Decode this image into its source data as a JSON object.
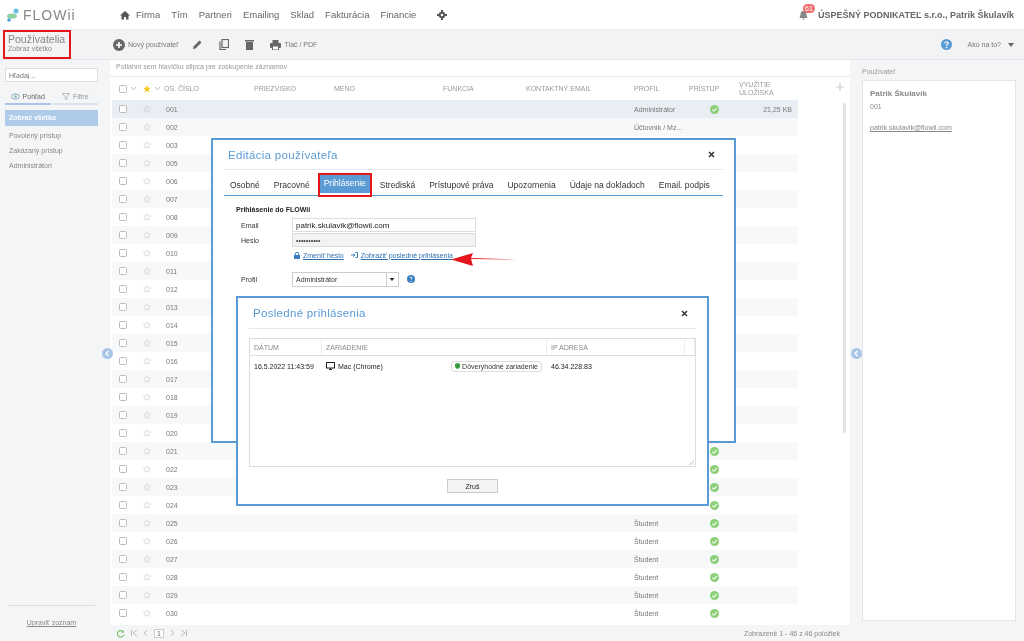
{
  "nav": {
    "logo": "FLOWii",
    "items": [
      "Firma",
      "Tím",
      "Partneri",
      "Emailing",
      "Sklad",
      "Fakturácia",
      "Financie"
    ],
    "notifications": "61",
    "account": "ÚSPEŠNÝ PODNIKATEĽ s.r.o., Patrik Škulavík"
  },
  "page_header": {
    "title": "Používatelia",
    "subtitle": "Zobraz všetko",
    "highlighted": true
  },
  "toolbar": {
    "new_button": "Nový používateľ",
    "print_button": "Tlač / PDF",
    "help": "Ako na to?"
  },
  "sidebar": {
    "search": {
      "placeholder": "Hľadaj..."
    },
    "tabs": [
      {
        "label": "Pohľad",
        "selected": true
      },
      {
        "label": "Filtre",
        "selected": false
      }
    ],
    "items": [
      {
        "label": "Zobraz všetko",
        "selected": true
      },
      {
        "label": "Povolený prístup",
        "selected": false
      },
      {
        "label": "Zakázaný prístup",
        "selected": false
      },
      {
        "label": "Administrátori",
        "selected": false
      }
    ],
    "footer_link": "Upraviť zoznam"
  },
  "table": {
    "group_hint": "Potiahni sem hlavičku stĺpca pre zoskupenie záznamov",
    "all_checked": false,
    "columns": [
      "OS. ČÍSLO",
      "PRIEZVISKO",
      "MENO",
      "FUNKCIA",
      "KONTAKTNÝ EMAIL",
      "PROFIL",
      "PRÍSTUP",
      "VYUŽITIE ÚLOŽISKA"
    ],
    "rows": [
      {
        "number": "001",
        "profile": "Administrátor",
        "access": true,
        "storage": "21,25 KB",
        "selected": true,
        "checked": false
      },
      {
        "number": "002",
        "profile": "Účtovník / Mz...",
        "access": false,
        "selected": false,
        "checked": false
      },
      {
        "number": "003",
        "selected": false,
        "checked": false
      },
      {
        "number": "005",
        "selected": false,
        "checked": false
      },
      {
        "number": "006",
        "selected": false,
        "checked": false
      },
      {
        "number": "007",
        "selected": false,
        "checked": false
      },
      {
        "number": "008",
        "selected": false,
        "checked": false
      },
      {
        "number": "009",
        "selected": false,
        "checked": false
      },
      {
        "number": "010",
        "selected": false,
        "checked": false
      },
      {
        "number": "011",
        "selected": false,
        "checked": false
      },
      {
        "number": "012",
        "selected": false,
        "checked": false
      },
      {
        "number": "013",
        "selected": false,
        "checked": false
      },
      {
        "number": "014",
        "selected": false,
        "checked": false
      },
      {
        "number": "015",
        "selected": false,
        "checked": false
      },
      {
        "number": "016",
        "selected": false,
        "checked": false
      },
      {
        "number": "017",
        "selected": false,
        "checked": false
      },
      {
        "number": "018",
        "selected": false,
        "checked": false
      },
      {
        "number": "019",
        "selected": false,
        "checked": false
      },
      {
        "number": "020",
        "selected": false,
        "checked": false
      },
      {
        "number": "021",
        "access": true,
        "selected": false,
        "checked": false
      },
      {
        "number": "022",
        "access": true,
        "selected": false,
        "checked": false
      },
      {
        "number": "023",
        "access": true,
        "selected": false,
        "checked": false
      },
      {
        "number": "024",
        "access": true,
        "selected": false,
        "checked": false
      },
      {
        "number": "025",
        "profile": "Študent",
        "access": true,
        "selected": false,
        "checked": false
      },
      {
        "number": "026",
        "profile": "Študent",
        "access": true,
        "selected": false,
        "checked": false
      },
      {
        "number": "027",
        "profile": "Študent",
        "access": true,
        "selected": false,
        "checked": false
      },
      {
        "number": "028",
        "profile": "Študent",
        "access": true,
        "selected": false,
        "checked": false
      },
      {
        "number": "029",
        "profile": "Študent",
        "access": true,
        "selected": false,
        "checked": false
      },
      {
        "number": "030",
        "profile": "Študent",
        "access": true,
        "selected": false,
        "checked": false
      }
    ],
    "page": "1",
    "summary": "Zobrazené 1 - 46 z 46 položiek"
  },
  "detail": {
    "label": "Používateľ",
    "name": "Patrik Škulavík",
    "number": "001",
    "email": "patrik.skulavik@flowii.com"
  },
  "edit_dialog": {
    "title": "Editácia používateľa",
    "tabs": [
      {
        "label": "Osobné",
        "selected": false,
        "highlighted": false
      },
      {
        "label": "Pracovné",
        "selected": false,
        "highlighted": false
      },
      {
        "label": "Prihlásenie",
        "selected": true,
        "highlighted": true
      },
      {
        "label": "Strediská",
        "selected": false,
        "highlighted": false
      },
      {
        "label": "Prístupové práva",
        "selected": false,
        "highlighted": false
      },
      {
        "label": "Upozornenia",
        "selected": false,
        "highlighted": false
      },
      {
        "label": "Údaje na dokladoch",
        "selected": false,
        "highlighted": false
      },
      {
        "label": "Email. podpis",
        "selected": false,
        "highlighted": false
      }
    ],
    "section": "Prihlásenie do FLOWii",
    "fields": [
      {
        "label": "Email",
        "value": "patrik.skulavik@flowii.com",
        "disabled": false
      },
      {
        "label": "Heslo",
        "value": "••••••••••",
        "disabled": true
      }
    ],
    "links": [
      {
        "kind": "lock",
        "label": "Zmeniť heslo"
      },
      {
        "kind": "signin",
        "label": "Zobraziť posledné prihlásenia"
      }
    ],
    "profile": {
      "label": "Profil",
      "value": "Administrátor"
    }
  },
  "logins_dialog": {
    "title": "Posledné prihlásenia",
    "columns": [
      "DÁTUM",
      "ZARIADENIE",
      "IP ADRESA"
    ],
    "rows": [
      {
        "date": "16.5.2022 11:43:59",
        "device": "Mac (Chrome)",
        "badge": "Dôveryhodné zariadenie",
        "ip": "46.34.228.83"
      }
    ],
    "button": "Zruš"
  }
}
